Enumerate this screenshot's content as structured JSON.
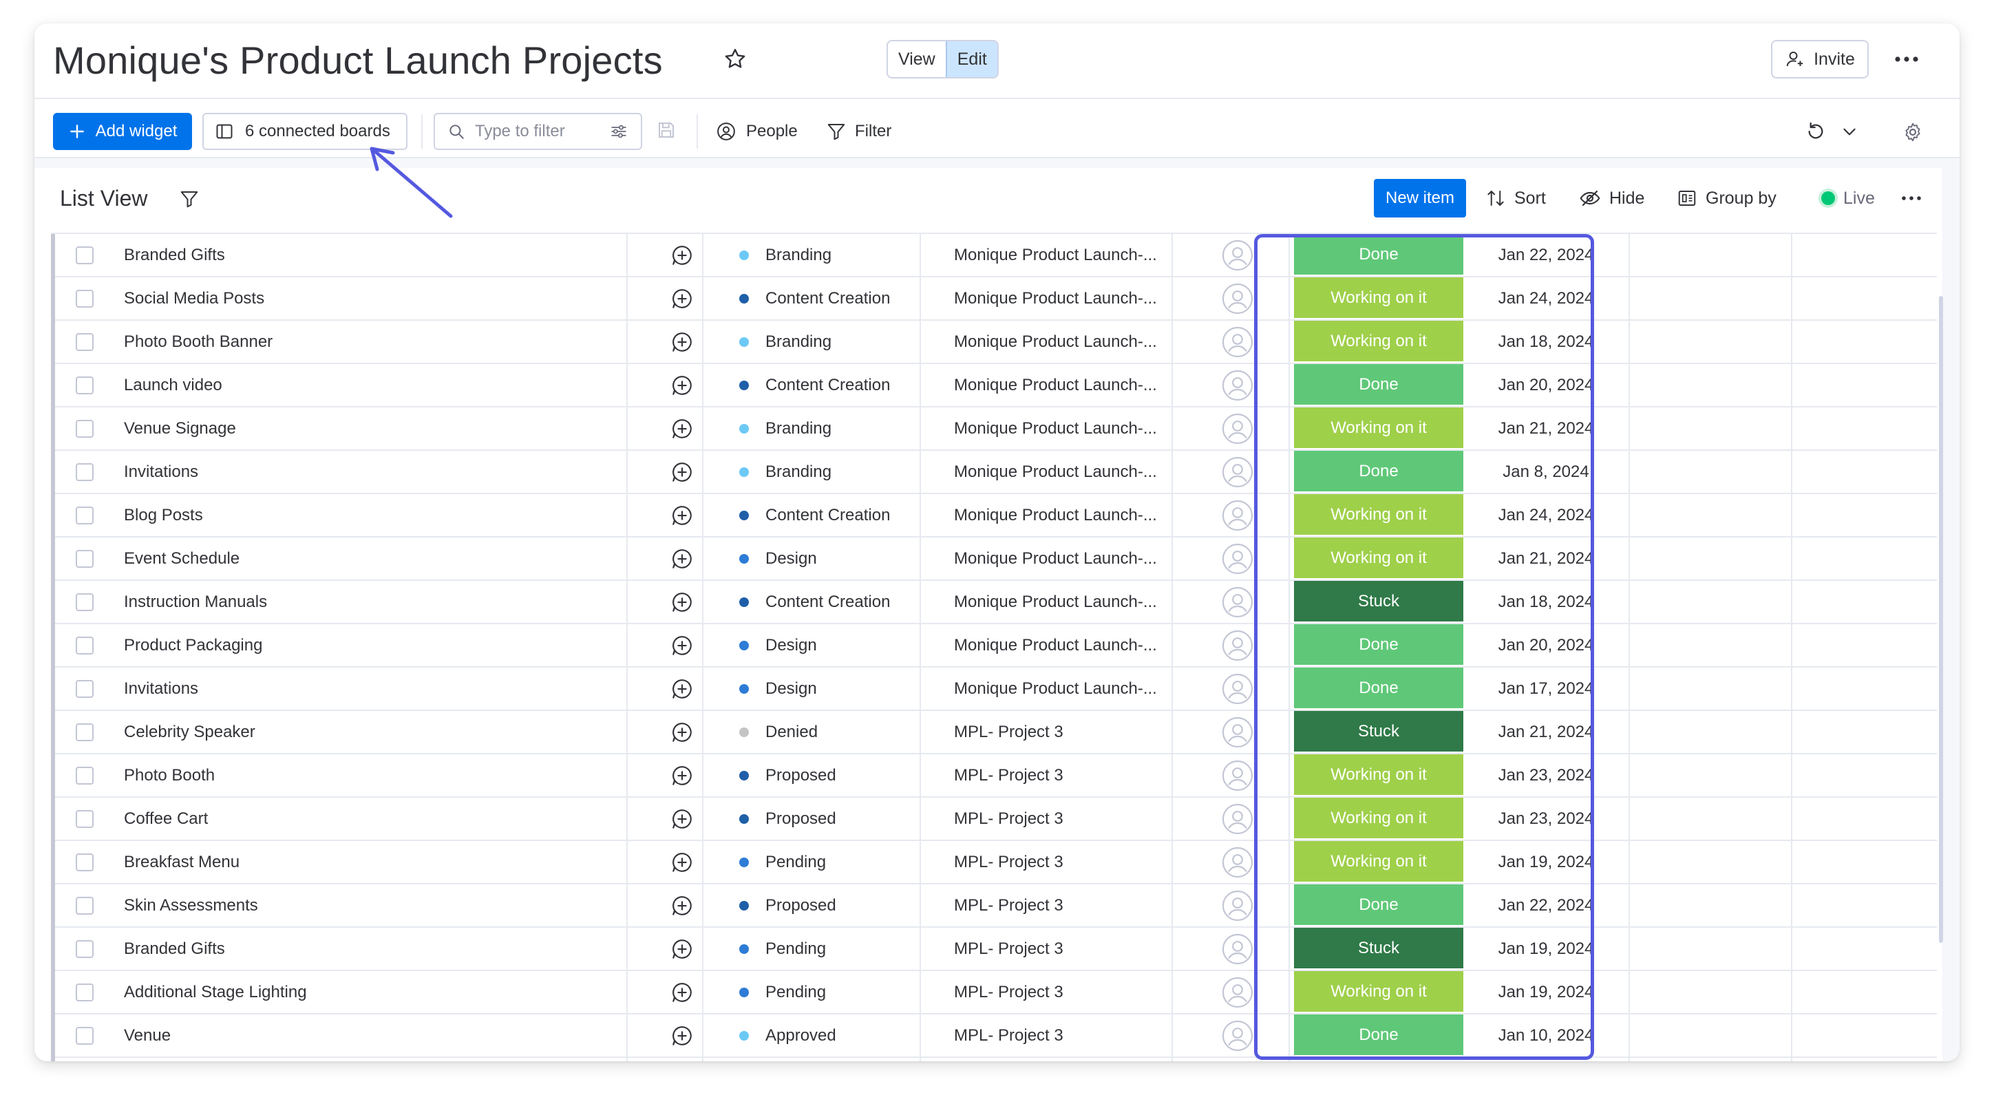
{
  "header": {
    "title": "Monique's Product Launch Projects",
    "view_label": "View",
    "edit_label": "Edit",
    "invite_label": "Invite"
  },
  "toolbar": {
    "add_widget_label": "Add widget",
    "connected_boards_label": "6 connected boards",
    "search_placeholder": "Type to filter",
    "people_label": "People",
    "filter_label": "Filter"
  },
  "list_view": {
    "title": "List View",
    "new_item_label": "New item",
    "sort_label": "Sort",
    "hide_label": "Hide",
    "group_by_label": "Group by",
    "live_label": "Live"
  },
  "colors": {
    "accent": "#0073ea",
    "annotation": "#5559df",
    "status_done": "#5fc878",
    "status_working": "#9fd04a",
    "status_stuck": "#2f7a48",
    "group_light_blue": "#66ccff",
    "group_dark_blue": "#1f76c2",
    "group_grey": "#c4c4c4"
  },
  "rows": [
    {
      "name": "Branded Gifts",
      "group": "Branding",
      "group_color": "#6cc9f5",
      "board": "Monique Product Launch-...",
      "status": "Done",
      "status_color": "#5fc878",
      "date": "Jan 22, 2024"
    },
    {
      "name": "Social Media Posts",
      "group": "Content Creation",
      "group_color": "#1f5fa8",
      "board": "Monique Product Launch-...",
      "status": "Working on it",
      "status_color": "#9fd04a",
      "date": "Jan 24, 2024"
    },
    {
      "name": "Photo Booth Banner",
      "group": "Branding",
      "group_color": "#6cc9f5",
      "board": "Monique Product Launch-...",
      "status": "Working on it",
      "status_color": "#9fd04a",
      "date": "Jan 18, 2024"
    },
    {
      "name": "Launch video",
      "group": "Content Creation",
      "group_color": "#1f5fa8",
      "board": "Monique Product Launch-...",
      "status": "Done",
      "status_color": "#5fc878",
      "date": "Jan 20, 2024"
    },
    {
      "name": "Venue Signage",
      "group": "Branding",
      "group_color": "#6cc9f5",
      "board": "Monique Product Launch-...",
      "status": "Working on it",
      "status_color": "#9fd04a",
      "date": "Jan 21, 2024"
    },
    {
      "name": "Invitations",
      "group": "Branding",
      "group_color": "#6cc9f5",
      "board": "Monique Product Launch-...",
      "status": "Done",
      "status_color": "#5fc878",
      "date": "Jan 8, 2024"
    },
    {
      "name": "Blog Posts",
      "group": "Content Creation",
      "group_color": "#1f5fa8",
      "board": "Monique Product Launch-...",
      "status": "Working on it",
      "status_color": "#9fd04a",
      "date": "Jan 24, 2024"
    },
    {
      "name": "Event Schedule",
      "group": "Design",
      "group_color": "#2e7cd6",
      "board": "Monique Product Launch-...",
      "status": "Working on it",
      "status_color": "#9fd04a",
      "date": "Jan 21, 2024"
    },
    {
      "name": "Instruction Manuals",
      "group": "Content Creation",
      "group_color": "#1f5fa8",
      "board": "Monique Product Launch-...",
      "status": "Stuck",
      "status_color": "#2f7a48",
      "date": "Jan 18, 2024"
    },
    {
      "name": "Product Packaging",
      "group": "Design",
      "group_color": "#2e7cd6",
      "board": "Monique Product Launch-...",
      "status": "Done",
      "status_color": "#5fc878",
      "date": "Jan 20, 2024"
    },
    {
      "name": "Invitations",
      "group": "Design",
      "group_color": "#2e7cd6",
      "board": "Monique Product Launch-...",
      "status": "Done",
      "status_color": "#5fc878",
      "date": "Jan 17, 2024"
    },
    {
      "name": "Celebrity Speaker",
      "group": "Denied",
      "group_color": "#c4c4c4",
      "board": "MPL- Project 3",
      "status": "Stuck",
      "status_color": "#2f7a48",
      "date": "Jan 21, 2024"
    },
    {
      "name": "Photo Booth",
      "group": "Proposed",
      "group_color": "#1f5fa8",
      "board": "MPL- Project 3",
      "status": "Working on it",
      "status_color": "#9fd04a",
      "date": "Jan 23, 2024"
    },
    {
      "name": "Coffee Cart",
      "group": "Proposed",
      "group_color": "#1f5fa8",
      "board": "MPL- Project 3",
      "status": "Working on it",
      "status_color": "#9fd04a",
      "date": "Jan 23, 2024"
    },
    {
      "name": "Breakfast Menu",
      "group": "Pending",
      "group_color": "#2e7cd6",
      "board": "MPL- Project 3",
      "status": "Working on it",
      "status_color": "#9fd04a",
      "date": "Jan 19, 2024"
    },
    {
      "name": "Skin Assessments",
      "group": "Proposed",
      "group_color": "#1f5fa8",
      "board": "MPL- Project 3",
      "status": "Done",
      "status_color": "#5fc878",
      "date": "Jan 22, 2024"
    },
    {
      "name": "Branded Gifts",
      "group": "Pending",
      "group_color": "#2e7cd6",
      "board": "MPL- Project 3",
      "status": "Stuck",
      "status_color": "#2f7a48",
      "date": "Jan 19, 2024"
    },
    {
      "name": "Additional Stage Lighting",
      "group": "Pending",
      "group_color": "#2e7cd6",
      "board": "MPL- Project 3",
      "status": "Working on it",
      "status_color": "#9fd04a",
      "date": "Jan 19, 2024"
    },
    {
      "name": "Venue",
      "group": "Approved",
      "group_color": "#6cc9f5",
      "board": "MPL- Project 3",
      "status": "Done",
      "status_color": "#5fc878",
      "date": "Jan 10, 2024"
    }
  ]
}
